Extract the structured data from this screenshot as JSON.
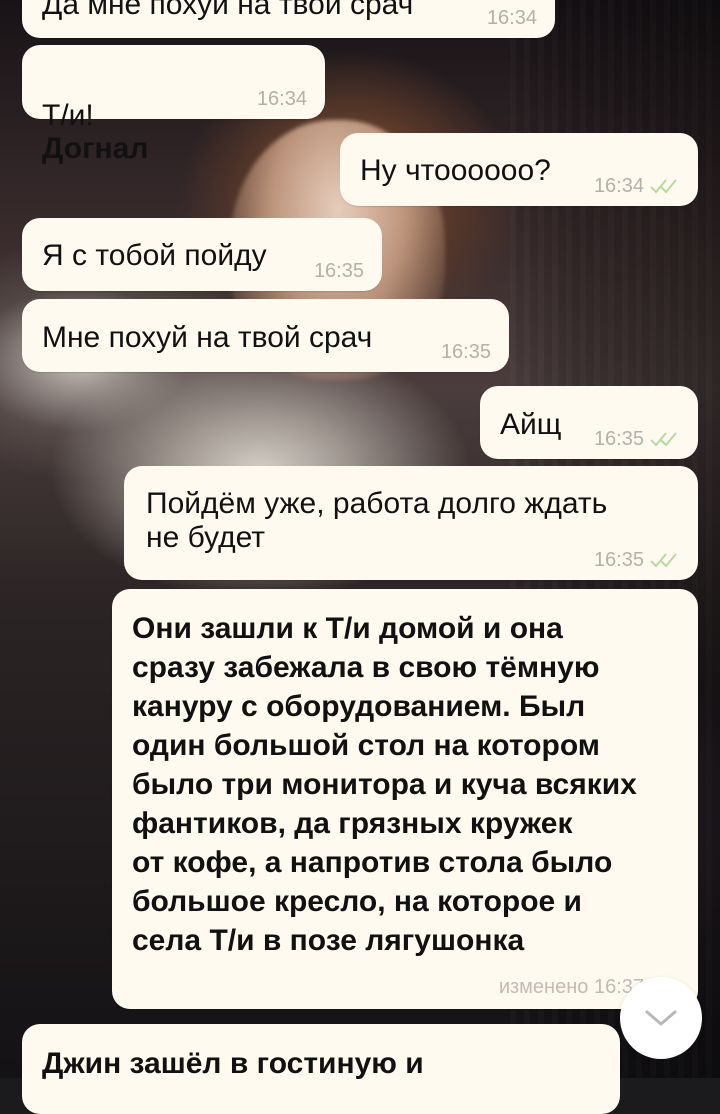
{
  "messages": [
    {
      "text": "Да мне похуй на твой срач",
      "time": "16:34",
      "direction": "incoming"
    },
    {
      "sender": "Т/и!",
      "text": "Догнал",
      "time": "16:34",
      "direction": "incoming"
    },
    {
      "text": "Ну чтоооооо?",
      "time": "16:34",
      "direction": "outgoing",
      "status_icon": "double-check-icon"
    },
    {
      "text": "Я с тобой пойду",
      "time": "16:35",
      "direction": "incoming"
    },
    {
      "text": "Мне похуй на твой срач",
      "time": "16:35",
      "direction": "incoming"
    },
    {
      "text": "Айщ",
      "time": "16:35",
      "direction": "outgoing",
      "status_icon": "double-check-icon"
    },
    {
      "text": "Пойдём уже, работа долго ждать\nне будет",
      "time": "16:35",
      "direction": "outgoing",
      "status_icon": "double-check-icon"
    },
    {
      "text": "Они зашли к Т/и домой и она\nсразу забежала в свою тёмную\nкануру с оборудованием. Был\nодин большой стол на котором\nбыло три монитора и куча всяких\nфантиков, да грязных кружек\nот кофе, а напротив стола было\nбольшое кресло, на которое и\nсела Т/и в позе лягушонка",
      "meta": "изменено 16:37",
      "direction": "outgoing",
      "status_icon": "double-check-icon"
    },
    {
      "text": "Джин зашёл в гостиную и",
      "direction": "incoming"
    }
  ],
  "controls": {
    "scroll_down_icon": "chevron-down-icon"
  },
  "colors": {
    "bubble": "#fffaf0",
    "text": "#111111",
    "meta": "#b5b0a8",
    "check": "#b8d9a2"
  }
}
